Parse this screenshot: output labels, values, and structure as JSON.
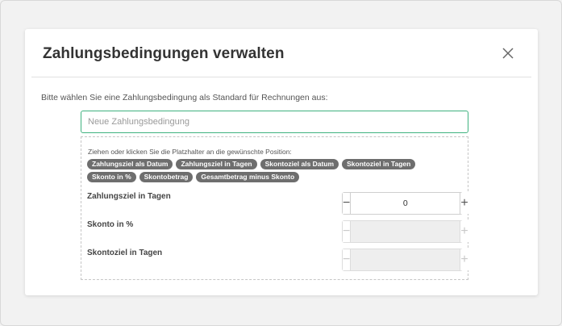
{
  "modal": {
    "title": "Zahlungsbedingungen verwalten",
    "close_icon": "close-icon",
    "intro": "Bitte wählen Sie eine Zahlungsbedingung als Standard für Rechnungen aus:"
  },
  "name_input": {
    "placeholder": "Neue Zahlungsbedingung",
    "value": ""
  },
  "placeholders": {
    "hint": "Ziehen oder klicken Sie die Platzhalter an die gewünschte Position:",
    "chips": [
      "Zahlungsziel als Datum",
      "Zahlungsziel in Tagen",
      "Skontoziel als Datum",
      "Skontoziel in Tagen",
      "Skonto in %",
      "Skontobetrag",
      "Gesamtbetrag minus Skonto"
    ]
  },
  "fields": [
    {
      "label": "Zahlungsziel in Tagen",
      "value": "0",
      "enabled": true,
      "minus": "−",
      "plus": "+"
    },
    {
      "label": "Skonto in %",
      "value": "",
      "enabled": false,
      "minus": "−",
      "plus": "+"
    },
    {
      "label": "Skontoziel in Tagen",
      "value": "",
      "enabled": false,
      "minus": "−",
      "plus": "+"
    }
  ],
  "colors": {
    "accent_border": "#3fb27f",
    "chip_bg": "#6e6e6e",
    "disabled_bg": "#eeeeee"
  }
}
